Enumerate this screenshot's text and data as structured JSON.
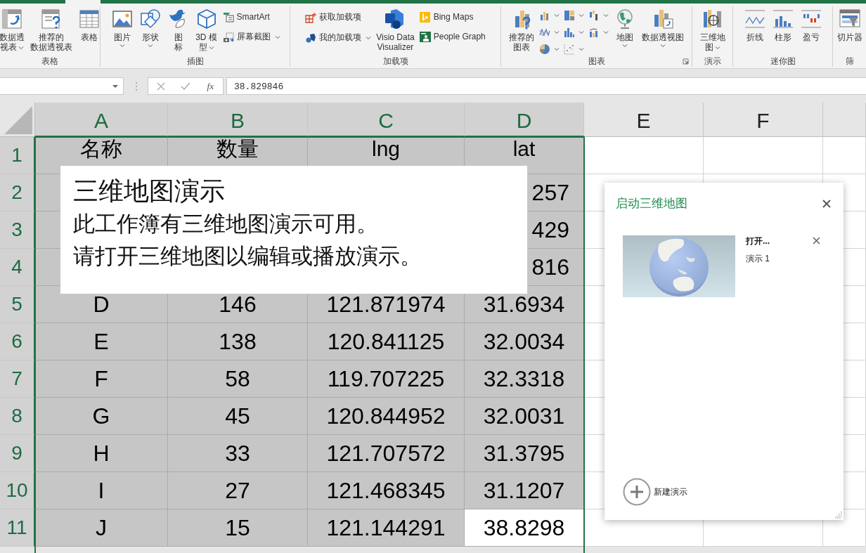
{
  "ribbon": {
    "groups": [
      {
        "label": "表格",
        "launcher": false,
        "items": [
          {
            "kind": "large",
            "lines": [
              "数据透",
              "视表"
            ],
            "dropdown": true
          },
          {
            "kind": "large",
            "lines": [
              "推荐的",
              "数据透视表"
            ],
            "dropdown": false
          },
          {
            "kind": "large",
            "lines": [
              "表格"
            ],
            "dropdown": false
          }
        ]
      },
      {
        "label": "插图",
        "launcher": false,
        "items": [
          {
            "kind": "large",
            "lines": [
              "图片"
            ],
            "dropdown": true
          },
          {
            "kind": "large",
            "lines": [
              "形状"
            ],
            "dropdown": true
          },
          {
            "kind": "large",
            "lines": [
              "图",
              "标"
            ],
            "dropdown": false
          },
          {
            "kind": "large",
            "lines": [
              "3D 模",
              "型"
            ],
            "dropdown": true
          },
          {
            "kind": "small",
            "lines": [
              "SmartArt"
            ],
            "dropdown": false
          },
          {
            "kind": "small",
            "lines": [
              "屏幕截图"
            ],
            "dropdown": true
          }
        ]
      },
      {
        "label": "加载项",
        "launcher": false,
        "items": [
          {
            "kind": "small",
            "lines": [
              "获取加载项"
            ],
            "dropdown": false
          },
          {
            "kind": "small",
            "lines": [
              "我的加载项"
            ],
            "dropdown": true
          },
          {
            "kind": "large",
            "lines": [
              "Visio Data",
              "Visualizer"
            ],
            "dropdown": false
          },
          {
            "kind": "small",
            "lines": [
              "Bing Maps"
            ],
            "dropdown": false
          },
          {
            "kind": "small",
            "lines": [
              "People Graph"
            ],
            "dropdown": false
          }
        ]
      },
      {
        "label": "图表",
        "launcher": true,
        "items": [
          {
            "kind": "large",
            "lines": [
              "推荐的",
              "图表"
            ],
            "dropdown": false
          },
          {
            "kind": "gallery"
          },
          {
            "kind": "large",
            "lines": [
              "地图"
            ],
            "dropdown": true
          },
          {
            "kind": "large",
            "lines": [
              "数据透视图"
            ],
            "dropdown": true
          }
        ]
      },
      {
        "label": "演示",
        "launcher": false,
        "items": [
          {
            "kind": "large",
            "lines": [
              "三维地",
              "图"
            ],
            "dropdown": true
          }
        ]
      },
      {
        "label": "迷你图",
        "launcher": false,
        "items": [
          {
            "kind": "large",
            "lines": [
              "折线"
            ],
            "dropdown": false
          },
          {
            "kind": "large",
            "lines": [
              "柱形"
            ],
            "dropdown": false
          },
          {
            "kind": "large",
            "lines": [
              "盈亏"
            ],
            "dropdown": false
          }
        ]
      },
      {
        "label": "筛",
        "launcher": false,
        "items": [
          {
            "kind": "large",
            "lines": [
              "切片器"
            ],
            "dropdown": false
          }
        ]
      }
    ]
  },
  "formula_bar": {
    "function_label": "fx",
    "value": "38.829846"
  },
  "sheet": {
    "columns": [
      {
        "letter": "A",
        "selected": true
      },
      {
        "letter": "B",
        "selected": true
      },
      {
        "letter": "C",
        "selected": true
      },
      {
        "letter": "D",
        "selected": true
      },
      {
        "letter": "E",
        "selected": false
      },
      {
        "letter": "F",
        "selected": false
      }
    ],
    "rows": [
      {
        "number": "1",
        "selected": true,
        "cells": [
          {
            "text": "名称",
            "active": false
          },
          {
            "text": "数量",
            "active": false
          },
          {
            "text": "lng",
            "active": false
          },
          {
            "text": "lat",
            "active": false
          }
        ]
      },
      {
        "number": "2",
        "selected": true,
        "covered": true,
        "cells": [
          {
            "text": "257",
            "active": false
          }
        ]
      },
      {
        "number": "3",
        "selected": true,
        "covered": true,
        "cells": [
          {
            "text": "429",
            "active": false
          }
        ]
      },
      {
        "number": "4",
        "selected": true,
        "covered": true,
        "cells": [
          {
            "text": "816",
            "active": false
          }
        ]
      },
      {
        "number": "5",
        "selected": true,
        "cells": [
          {
            "text": "D",
            "active": false
          },
          {
            "text": "146",
            "active": false
          },
          {
            "text": "121.871974",
            "active": false
          },
          {
            "text": "31.6934",
            "active": false
          }
        ]
      },
      {
        "number": "6",
        "selected": true,
        "cells": [
          {
            "text": "E",
            "active": false
          },
          {
            "text": "138",
            "active": false
          },
          {
            "text": "120.841125",
            "active": false
          },
          {
            "text": "32.0034",
            "active": false
          }
        ]
      },
      {
        "number": "7",
        "selected": true,
        "cells": [
          {
            "text": "F",
            "active": false
          },
          {
            "text": "58",
            "active": false
          },
          {
            "text": "119.707225",
            "active": false
          },
          {
            "text": "32.3318",
            "active": false
          }
        ]
      },
      {
        "number": "8",
        "selected": true,
        "cells": [
          {
            "text": "G",
            "active": false
          },
          {
            "text": "45",
            "active": false
          },
          {
            "text": "120.844952",
            "active": false
          },
          {
            "text": "32.0031",
            "active": false
          }
        ]
      },
      {
        "number": "9",
        "selected": true,
        "cells": [
          {
            "text": "H",
            "active": false
          },
          {
            "text": "33",
            "active": false
          },
          {
            "text": "121.707572",
            "active": false
          },
          {
            "text": "31.3795",
            "active": false
          }
        ]
      },
      {
        "number": "10",
        "selected": true,
        "cells": [
          {
            "text": "I",
            "active": false
          },
          {
            "text": "27",
            "active": false
          },
          {
            "text": "121.468345",
            "active": false
          },
          {
            "text": "31.1207",
            "active": false
          }
        ]
      },
      {
        "number": "11",
        "selected": true,
        "cells": [
          {
            "text": "J",
            "active": false
          },
          {
            "text": "15",
            "active": false
          },
          {
            "text": "121.144291",
            "active": false
          },
          {
            "text": "38.8298",
            "active": true
          }
        ]
      }
    ]
  },
  "message": {
    "title": "三维地图演示",
    "lines": [
      "此工作簿有三维地图演示可用。",
      "请打开三维地图以编辑或播放演示。"
    ]
  },
  "panel": {
    "title": "启动三维地图",
    "tours": [
      {
        "kind": "picture",
        "title": "打开...",
        "subtitle": "演示 1"
      }
    ],
    "new_button": "新建演示"
  }
}
